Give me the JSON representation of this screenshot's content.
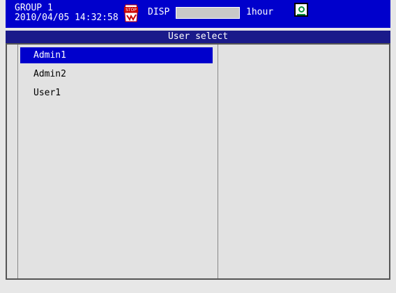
{
  "status": {
    "group": "GROUP 1",
    "datetime": "2010/04/05 14:32:58",
    "stop_icon": "stop-icon",
    "disp_label": "DISP",
    "time_span": "1hour",
    "media_icon": "media-icon"
  },
  "title": "User select",
  "users": [
    "Admin1",
    "Admin2",
    "User1"
  ],
  "selected_index": 0,
  "colors": {
    "header_bg": "#0000cc",
    "title_bg": "#1a1a8a",
    "selection": "#0000cc"
  }
}
